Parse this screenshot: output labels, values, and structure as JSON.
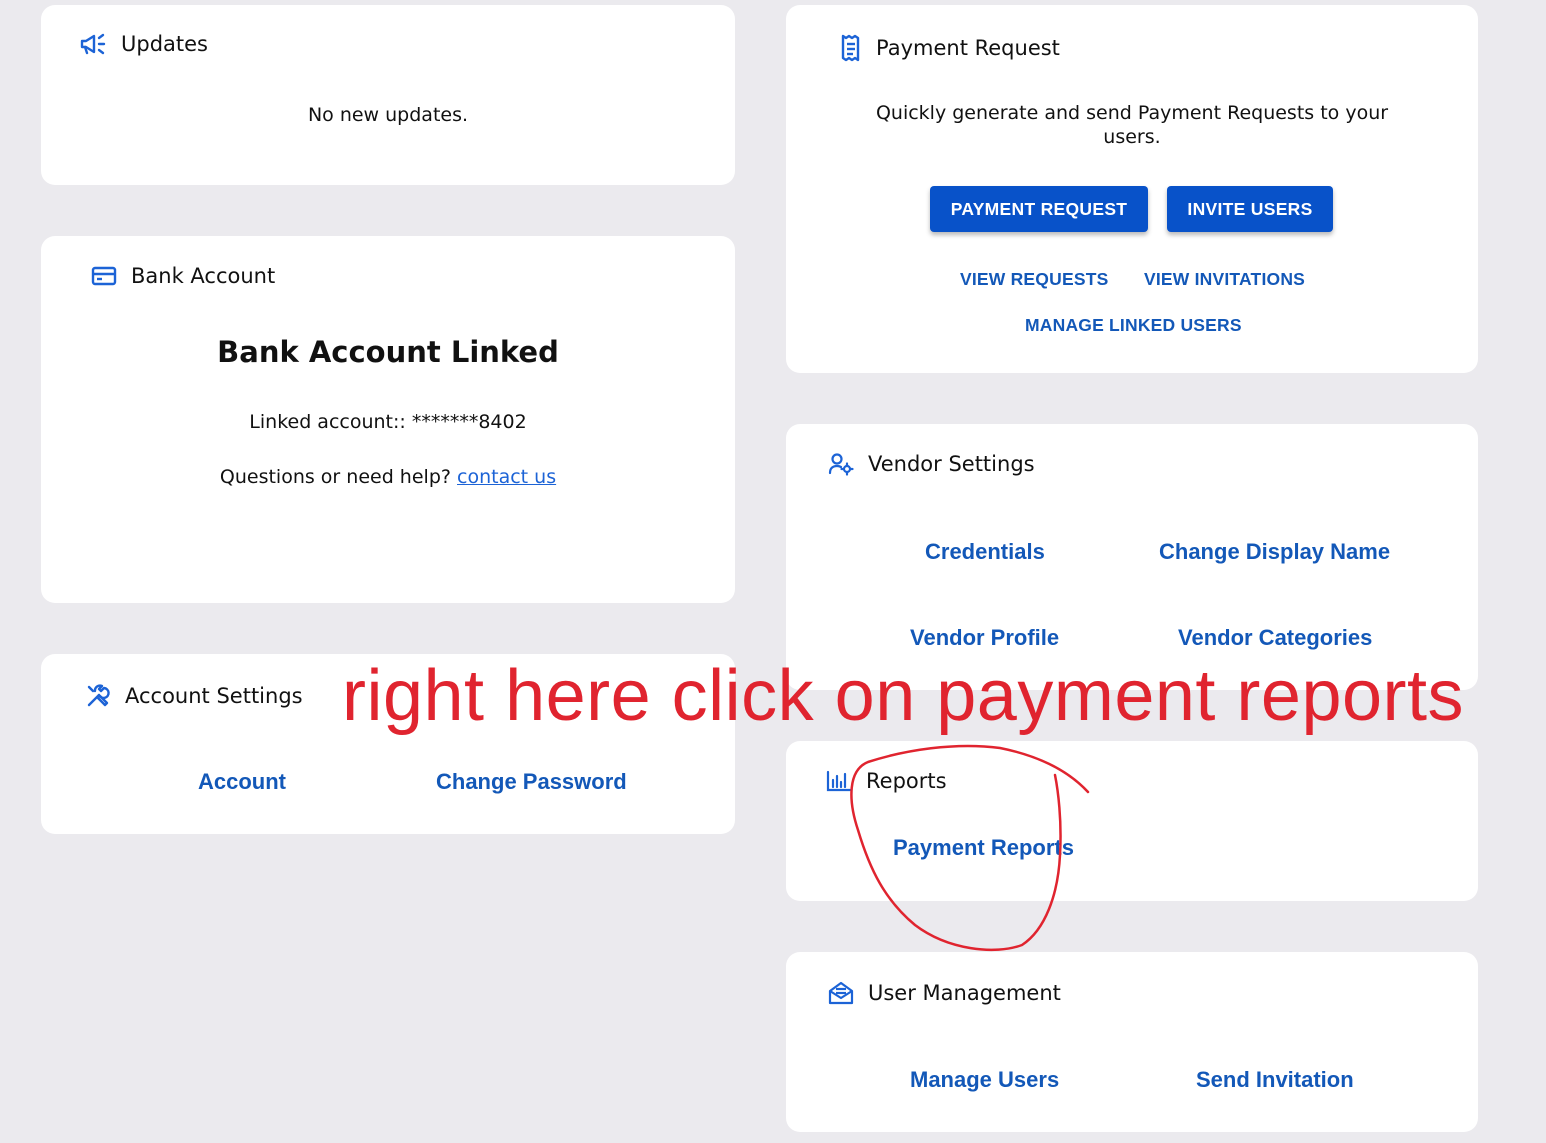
{
  "updates": {
    "title": "Updates",
    "icon": "megaphone-icon",
    "message": "No new updates."
  },
  "bank_account": {
    "title": "Bank Account",
    "icon": "credit-card-icon",
    "status": "Bank Account Linked",
    "linked_label": "Linked account:: *******8402",
    "help_text": "Questions or need help?",
    "contact_link": "contact us"
  },
  "account_settings": {
    "title": "Account Settings",
    "icon": "tools-icon",
    "links": {
      "account": "Account",
      "change_password": "Change Password"
    }
  },
  "payment_request": {
    "title": "Payment Request",
    "icon": "receipt-icon",
    "description": "Quickly generate and send Payment Requests to your users.",
    "buttons": {
      "payment_request": "PAYMENT REQUEST",
      "invite_users": "INVITE USERS"
    },
    "links": {
      "view_requests": "VIEW REQUESTS",
      "view_invitations": "VIEW INVITATIONS",
      "manage_linked_users": "MANAGE LINKED USERS"
    }
  },
  "vendor_settings": {
    "title": "Vendor Settings",
    "icon": "user-gear-icon",
    "links": {
      "credentials": "Credentials",
      "change_display_name": "Change Display Name",
      "vendor_profile": "Vendor Profile",
      "vendor_categories": "Vendor Categories"
    }
  },
  "reports": {
    "title": "Reports",
    "icon": "bar-chart-icon",
    "links": {
      "payment_reports": "Payment Reports"
    }
  },
  "user_management": {
    "title": "User Management",
    "icon": "mail-envelope-icon",
    "links": {
      "manage_users": "Manage Users",
      "send_invitation": "Send Invitation"
    }
  },
  "annotation": {
    "text": "right here click on payment reports",
    "color": "#e0242f"
  },
  "colors": {
    "accent": "#0852c9",
    "link": "#1358b8",
    "icon": "#1c63d6",
    "background": "#ebeaee"
  }
}
